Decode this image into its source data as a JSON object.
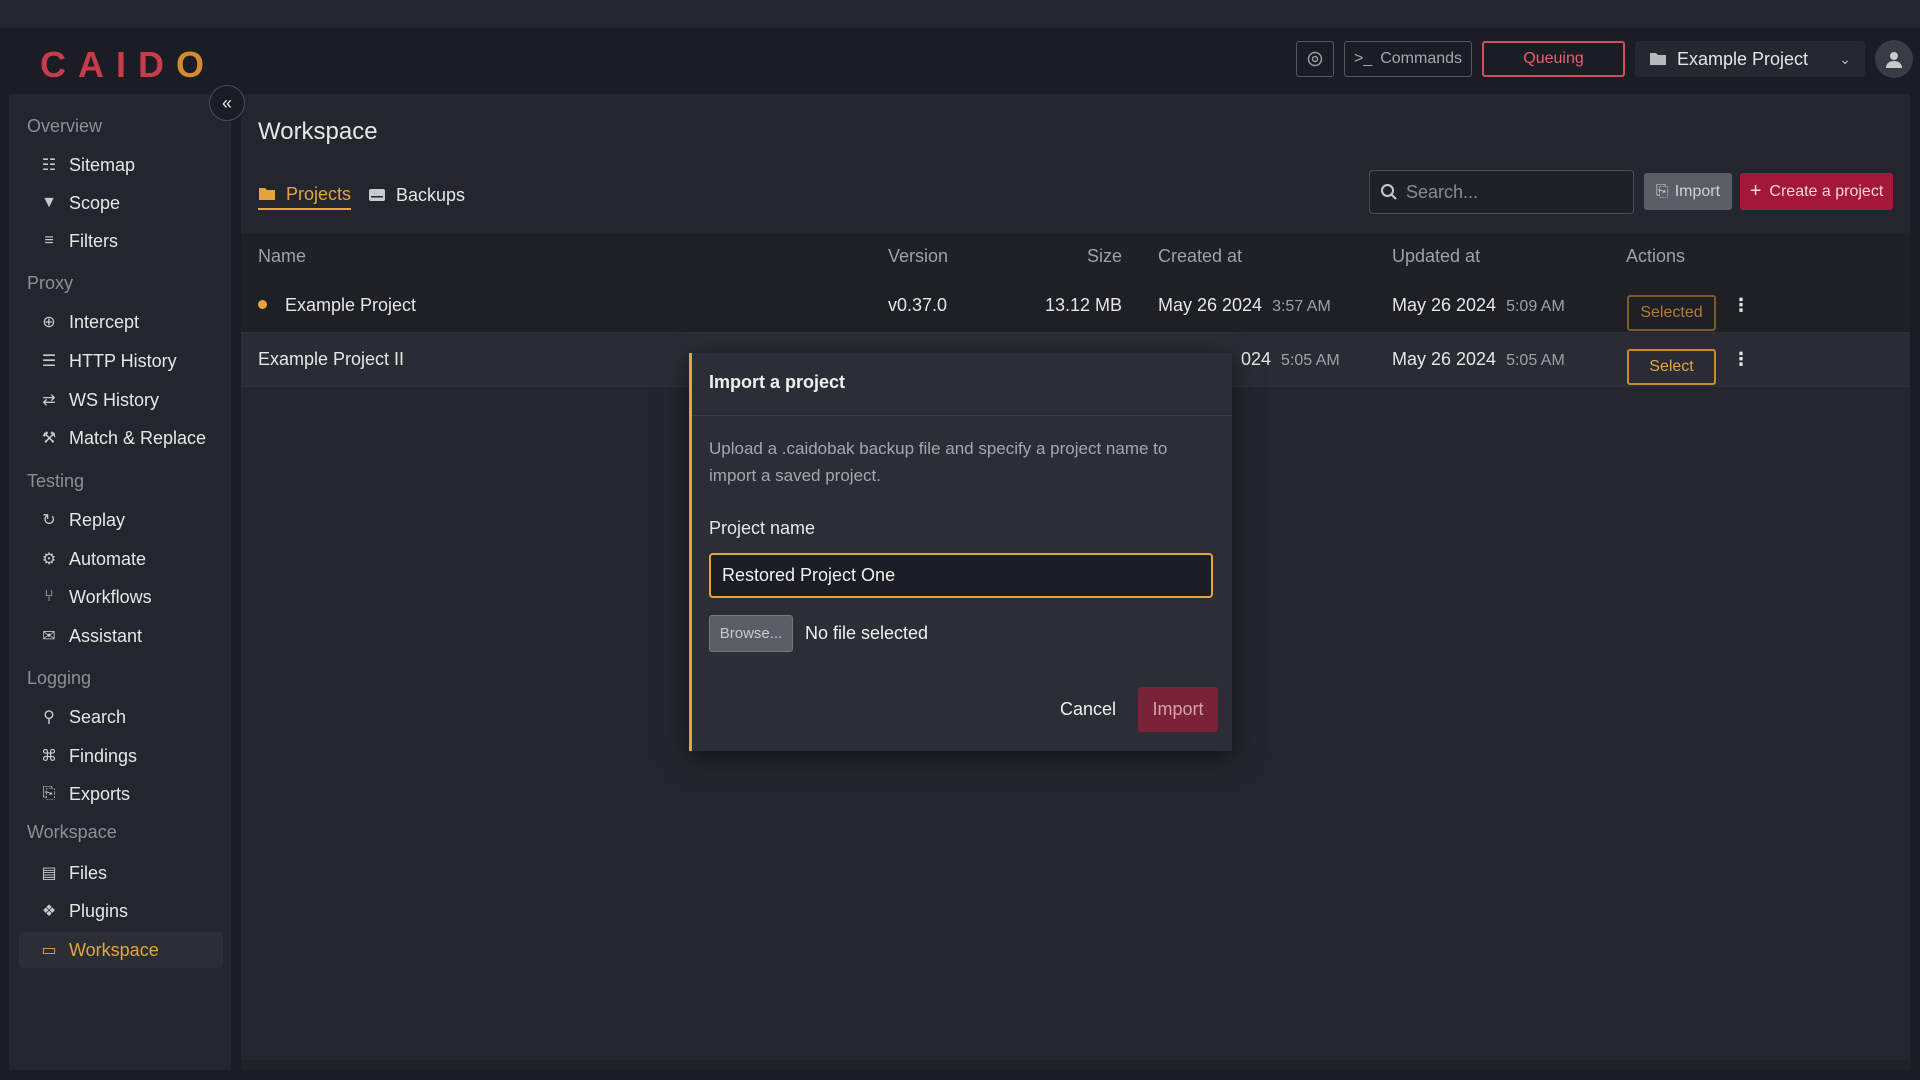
{
  "header": {
    "logo_main": "CAID",
    "logo_accent": "O",
    "commands_label": "Commands",
    "queue_label": "Queuing",
    "project_name": "Example Project"
  },
  "sidebar": {
    "sections": [
      {
        "title": "Overview",
        "items": [
          "Sitemap",
          "Scope",
          "Filters"
        ]
      },
      {
        "title": "Proxy",
        "items": [
          "Intercept",
          "HTTP History",
          "WS History",
          "Match & Replace"
        ]
      },
      {
        "title": "Testing",
        "items": [
          "Replay",
          "Automate",
          "Workflows",
          "Assistant"
        ]
      },
      {
        "title": "Logging",
        "items": [
          "Search",
          "Findings",
          "Exports"
        ]
      },
      {
        "title": "Workspace",
        "items": [
          "Files",
          "Plugins",
          "Workspace"
        ]
      }
    ]
  },
  "main": {
    "title": "Workspace",
    "tabs": {
      "projects": "Projects",
      "backups": "Backups"
    },
    "search_placeholder": "Search...",
    "import_label": "Import",
    "create_label": "Create a project",
    "columns": {
      "name": "Name",
      "version": "Version",
      "size": "Size",
      "created": "Created at",
      "updated": "Updated at",
      "actions": "Actions"
    },
    "rows": [
      {
        "name": "Example Project",
        "version": "v0.37.0",
        "size": "13.12 MB",
        "created_date": "May 26 2024",
        "created_time": "3:57 AM",
        "updated_date": "May 26 2024",
        "updated_time": "5:09 AM",
        "action": "Selected"
      },
      {
        "name": "Example Project II",
        "created_date": "024",
        "created_time": "5:05 AM",
        "updated_date": "May 26 2024",
        "updated_time": "5:05 AM",
        "action": "Select"
      }
    ]
  },
  "modal": {
    "title": "Import a project",
    "description": "Upload a .caidobak backup file and specify a project name to import a saved project.",
    "field_label": "Project name",
    "field_value": "Restored Project One",
    "browse_label": "Browse...",
    "file_status": "No file selected",
    "cancel_label": "Cancel",
    "import_label": "Import"
  },
  "colors": {
    "accent": "#e8a33d",
    "danger": "#d64c5c",
    "primary": "#a31838"
  }
}
